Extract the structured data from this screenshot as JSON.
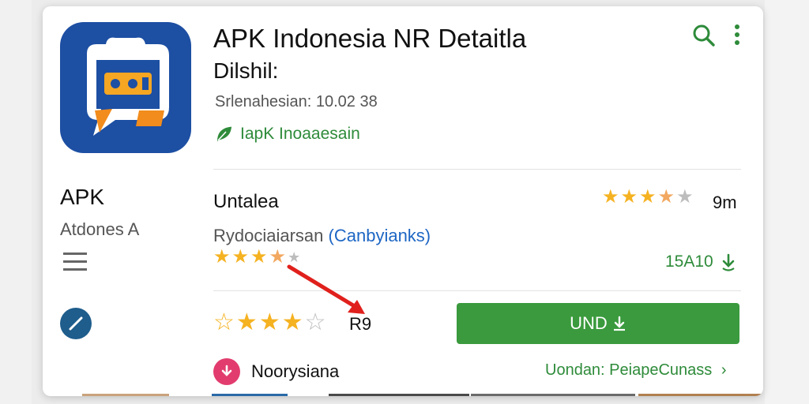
{
  "app": {
    "title": "APK Indonesia NR Detaitla",
    "subtitle": "Dilshil:",
    "meta": "Srlenahesian: 10.02 38",
    "developer": "IapK Inoaaesain"
  },
  "sidebar": {
    "title": "APK",
    "subtitle": "Atdones A"
  },
  "details": {
    "section_title": "Untalea",
    "rating_count": "9m",
    "description": "Rydociaiarsan",
    "description_link": "(Canbyianks)",
    "size": "15A10",
    "rate_label": "R9"
  },
  "actions": {
    "install_label": "UND"
  },
  "publisher": {
    "name": "Noorysiana",
    "link_label": "Uondan: PeiapeCunass"
  },
  "ratings": {
    "top_stars": 3.5,
    "mid_stars": 3.5,
    "user_stars": 3
  },
  "colors": {
    "accent_green": "#3a9a3d",
    "star_gold": "#f5b221",
    "icon_blue": "#1d4fa3",
    "arrow_red": "#e0201c"
  }
}
